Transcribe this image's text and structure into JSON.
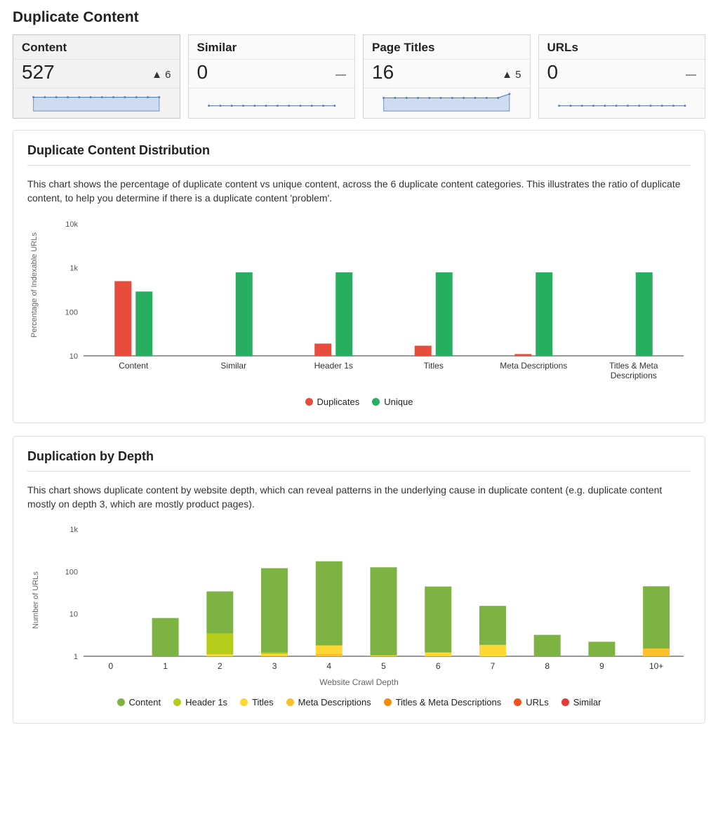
{
  "page_title": "Duplicate Content",
  "metrics": [
    {
      "label": "Content",
      "value": "527",
      "delta_arrow": "▲",
      "delta": "6",
      "selected": true,
      "spark_filled": true
    },
    {
      "label": "Similar",
      "value": "0",
      "delta_arrow": "—",
      "delta": "",
      "selected": false,
      "spark_filled": false
    },
    {
      "label": "Page Titles",
      "value": "16",
      "delta_arrow": "▲",
      "delta": "5",
      "selected": false,
      "spark_filled": true
    },
    {
      "label": "URLs",
      "value": "0",
      "delta_arrow": "—",
      "delta": "",
      "selected": false,
      "spark_filled": false
    }
  ],
  "panel1": {
    "title": "Duplicate Content Distribution",
    "desc": "This chart shows the percentage of duplicate content vs unique content, across the 6 duplicate content categories. This illustrates the ratio of duplicate content, to help you determine if there is a duplicate content 'problem'.",
    "ylabel": "Percentage of Indexable URLs",
    "legend": {
      "dup": "Duplicates",
      "uni": "Unique"
    }
  },
  "panel2": {
    "title": "Duplication by Depth",
    "desc": "This chart shows duplicate content by website depth, which can reveal patterns in the underlying cause in duplicate content (e.g. duplicate content mostly on depth 3, which are mostly product pages).",
    "ylabel": "Number of URLs",
    "xlabel": "Website Crawl Depth",
    "legend": [
      "Content",
      "Header 1s",
      "Titles",
      "Meta Descriptions",
      "Titles & Meta Descriptions",
      "URLs",
      "Similar"
    ]
  },
  "chart_data": [
    {
      "type": "bar",
      "title": "Duplicate Content Distribution",
      "ylabel": "Percentage of Indexable URLs",
      "yscale": "log",
      "ylim": [
        10,
        10000
      ],
      "yticks": [
        10,
        100,
        1000,
        10000
      ],
      "ytick_labels": [
        "10",
        "100",
        "1k",
        "10k"
      ],
      "categories": [
        "Content",
        "Similar",
        "Header 1s",
        "Titles",
        "Meta Descriptions",
        "Titles & Meta Descriptions"
      ],
      "series": [
        {
          "name": "Duplicates",
          "color": "#e74c3c",
          "values": [
            500,
            0,
            19,
            17,
            11,
            0
          ]
        },
        {
          "name": "Unique",
          "color": "#27ae60",
          "values": [
            290,
            790,
            790,
            790,
            790,
            790
          ]
        }
      ],
      "legend_position": "bottom"
    },
    {
      "type": "bar_stacked",
      "title": "Duplication by Depth",
      "ylabel": "Number of URLs",
      "xlabel": "Website Crawl Depth",
      "yscale": "log",
      "ylim": [
        1,
        1000
      ],
      "yticks": [
        1,
        10,
        100,
        1000
      ],
      "ytick_labels": [
        "1",
        "10",
        "100",
        "1k"
      ],
      "categories": [
        "0",
        "1",
        "2",
        "3",
        "4",
        "5",
        "6",
        "7",
        "8",
        "9",
        "10+"
      ],
      "series": [
        {
          "name": "Content",
          "color": "#7cb342",
          "values": [
            0,
            8,
            22,
            115,
            155,
            125,
            42,
            12,
            3.2,
            2.2,
            40
          ]
        },
        {
          "name": "Header 1s",
          "color": "#b5cc18",
          "values": [
            0,
            0,
            11,
            2,
            0,
            0,
            0,
            0,
            0,
            0,
            0
          ]
        },
        {
          "name": "Titles",
          "color": "#fdd835",
          "values": [
            0,
            0,
            1,
            2,
            15,
            1.2,
            2.4,
            3.5,
            0,
            0,
            0
          ]
        },
        {
          "name": "Meta Descriptions",
          "color": "#fbc02d",
          "values": [
            0,
            0,
            0,
            1.2,
            5,
            0,
            0,
            0,
            0,
            0,
            5
          ]
        },
        {
          "name": "Titles & Meta Descriptions",
          "color": "#fb8c00",
          "values": [
            0,
            0,
            0,
            0,
            0,
            0,
            0,
            0,
            0,
            0,
            0
          ]
        },
        {
          "name": "URLs",
          "color": "#f4511e",
          "values": [
            0,
            0,
            0,
            0,
            0,
            0,
            0,
            0,
            0,
            0,
            0
          ]
        },
        {
          "name": "Similar",
          "color": "#e53935",
          "values": [
            0,
            0,
            0,
            0,
            0,
            0,
            0,
            0,
            0,
            0,
            0
          ]
        }
      ],
      "legend_position": "bottom"
    }
  ]
}
